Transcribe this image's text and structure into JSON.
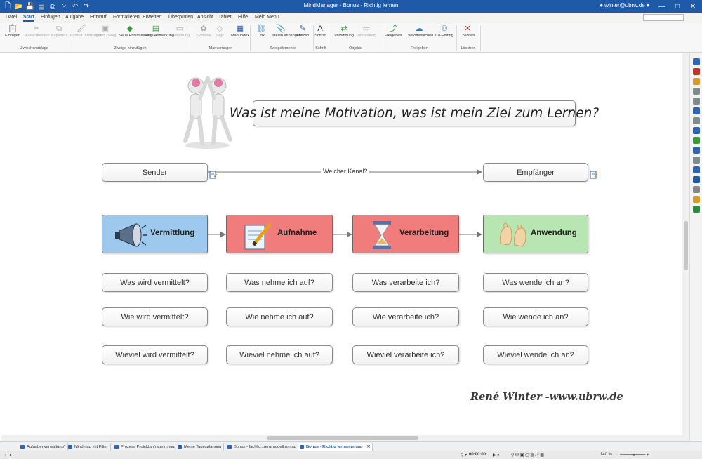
{
  "window": {
    "title": "MindManager - Bonus - Richtig lernen",
    "user": "winter@ubrw.de",
    "qat_icons": [
      "new-file-icon",
      "open-icon",
      "save-icon",
      "save-all-icon",
      "print-icon",
      "help-icon",
      "undo-icon",
      "redo-icon"
    ]
  },
  "menu": {
    "tabs": [
      "Datei",
      "Start",
      "Einfügen",
      "Aufgabe",
      "Entwurf",
      "Formatieren",
      "Erweitert",
      "Überprüfen",
      "Ansicht",
      "Tablet",
      "Hilfe",
      "Mein Menü"
    ],
    "active": "Start"
  },
  "ribbon": {
    "buttons": [
      {
        "label": "Einfügen",
        "icon": "📋",
        "color": "#c48a2a",
        "disabled": false
      },
      {
        "label": "Ausschneiden",
        "icon": "✂",
        "color": "#888",
        "disabled": true
      },
      {
        "label": "Kopieren",
        "icon": "⧉",
        "color": "#888",
        "disabled": true
      },
      {
        "label": "Format übertragen",
        "icon": "🖌",
        "color": "#c48a2a",
        "disabled": true
      },
      {
        "label": "Neuer Zweig",
        "icon": "▣",
        "color": "#3a9a3a",
        "disabled": true
      },
      {
        "label": "Neue Entscheidung",
        "icon": "◆",
        "color": "#3a9a3a",
        "disabled": false
      },
      {
        "label": "Freie Anmerkung",
        "icon": "▤",
        "color": "#3a9a3a",
        "disabled": false
      },
      {
        "label": "Anmerkung",
        "icon": "▭",
        "color": "#3a9a3a",
        "disabled": true
      },
      {
        "label": "Symbole",
        "icon": "✿",
        "color": "#c0392b",
        "disabled": true
      },
      {
        "label": "Tags",
        "icon": "◇",
        "color": "#2f7fc8",
        "disabled": true
      },
      {
        "label": "Map-Index",
        "icon": "▦",
        "color": "#2f63b3",
        "disabled": false
      },
      {
        "label": "Link",
        "icon": "⛓",
        "color": "#2f7fc8",
        "disabled": false
      },
      {
        "label": "Dateien anhängen",
        "icon": "📎",
        "color": "#777",
        "disabled": false
      },
      {
        "label": "Notizen",
        "icon": "✎",
        "color": "#2f63b3",
        "disabled": false
      },
      {
        "label": "Schrift",
        "icon": "A",
        "color": "#333",
        "disabled": false
      },
      {
        "label": "Verbindung",
        "icon": "⇄",
        "color": "#3a9a3a",
        "disabled": false
      },
      {
        "label": "Umrandung",
        "icon": "▭",
        "color": "#3a9a3a",
        "disabled": true
      },
      {
        "label": "Freigeben",
        "icon": "⤴",
        "color": "#3a9a3a",
        "disabled": false
      },
      {
        "label": "Veröffentlichen",
        "icon": "☁",
        "color": "#2f7fc8",
        "disabled": false
      },
      {
        "label": "Co-Editing",
        "icon": "⚇",
        "color": "#2f63b3",
        "disabled": false
      },
      {
        "label": "Löschen",
        "icon": "✕",
        "color": "#d32f2f",
        "disabled": false
      }
    ],
    "groups": [
      "Zwischenablage",
      "Zweige hinzufügen",
      "Markierungen",
      "Zweigelemente",
      "Schrift",
      "Objekte",
      "Freigeben",
      "Löschen"
    ]
  },
  "map": {
    "central_question": "Was ist meine Motivation, was ist mein Ziel zum Lernen?",
    "sender": "Sender",
    "receiver": "Empfänger",
    "channel_label": "Welcher Kanal?",
    "phases": [
      {
        "label": "Vermittlung",
        "color": "#9dc9ee",
        "icon": "megaphone-icon"
      },
      {
        "label": "Aufnahme",
        "color": "#f07c7c",
        "icon": "notepad-icon"
      },
      {
        "label": "Verarbeitung",
        "color": "#f07c7c",
        "icon": "hourglass-icon"
      },
      {
        "label": "Anwendung",
        "color": "#b8e6b3",
        "icon": "feet-icon"
      }
    ],
    "questions": [
      [
        "Was wird vermittelt?",
        "Was nehme ich auf?",
        "Was verarbeite ich?",
        "Was wende ich an?"
      ],
      [
        "Wie wird vermittelt?",
        "Wie nehme ich auf?",
        "Wie verarbeite ich?",
        "Wie wende ich an?"
      ],
      [
        "Wieviel wird vermittelt?",
        "Wieviel nehme ich auf?",
        "Wieviel verarbeite ich?",
        "Wieviel wende ich an?"
      ]
    ],
    "signature": "René Winter -www.ubrw.de"
  },
  "doc_tabs": [
    {
      "label": "Aufgabenverwaltung*",
      "active": false
    },
    {
      "label": "Mindmap mit Filter",
      "active": false
    },
    {
      "label": "Prozess Projektanfrage.mmap",
      "active": false
    },
    {
      "label": "Meine Tagesplanung",
      "active": false
    },
    {
      "label": "Bonus - fachlic...renzmodell.mmap",
      "active": false
    },
    {
      "label": "Bonus - Richtig lernen.mmap",
      "active": true
    }
  ],
  "status": {
    "time": "00:00:00",
    "zoom": "140 %"
  }
}
